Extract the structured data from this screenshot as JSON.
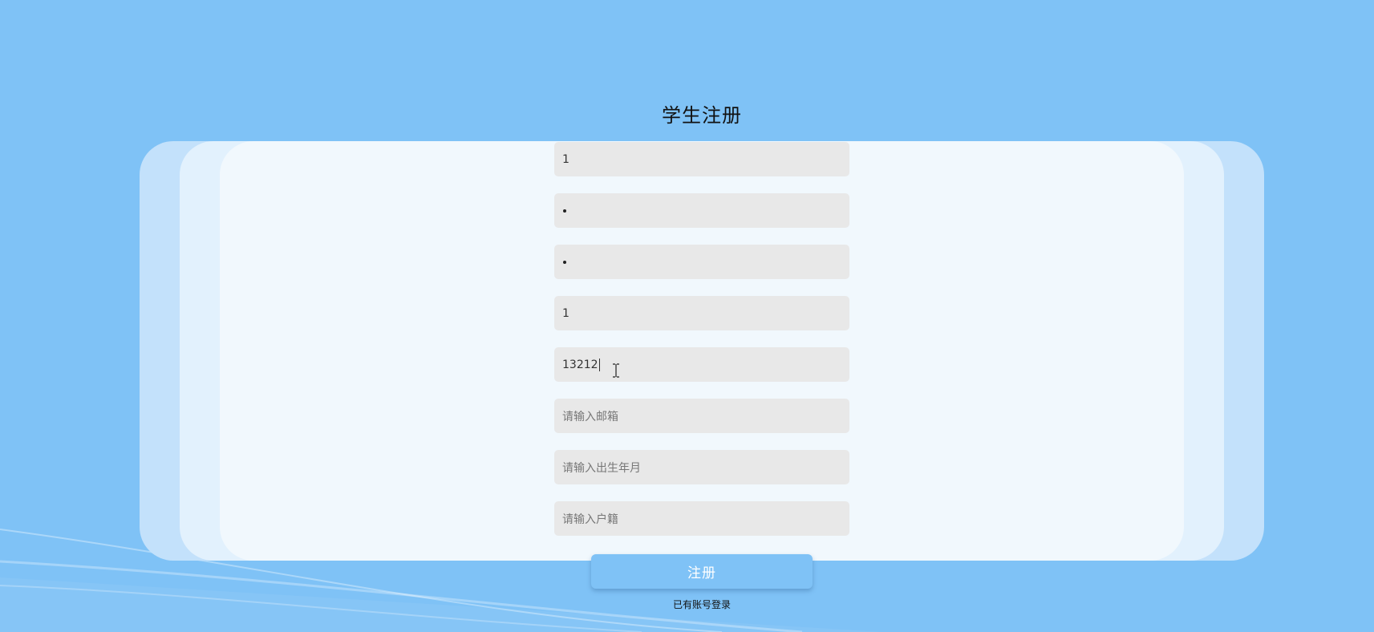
{
  "page": {
    "title": "学生注册",
    "background_color": "#7fc2f6"
  },
  "form": {
    "fields": [
      {
        "name": "username",
        "value": "1",
        "placeholder": ""
      },
      {
        "name": "password",
        "value": "•",
        "placeholder": ""
      },
      {
        "name": "confirm-password",
        "value": "•",
        "placeholder": ""
      },
      {
        "name": "name",
        "value": "1",
        "placeholder": ""
      },
      {
        "name": "phone",
        "value": "13212",
        "placeholder": ""
      },
      {
        "name": "email",
        "value": "",
        "placeholder": "请输入邮箱"
      },
      {
        "name": "birth-date",
        "value": "",
        "placeholder": "请输入出生年月"
      },
      {
        "name": "household-registration",
        "value": "",
        "placeholder": "请输入户籍"
      }
    ],
    "submit_label": "注册",
    "login_link": "已有账号登录"
  },
  "colors": {
    "field_background": "#e8e8e8",
    "panel_inner": "#f1f8fd",
    "button": "#7fc2f6"
  }
}
